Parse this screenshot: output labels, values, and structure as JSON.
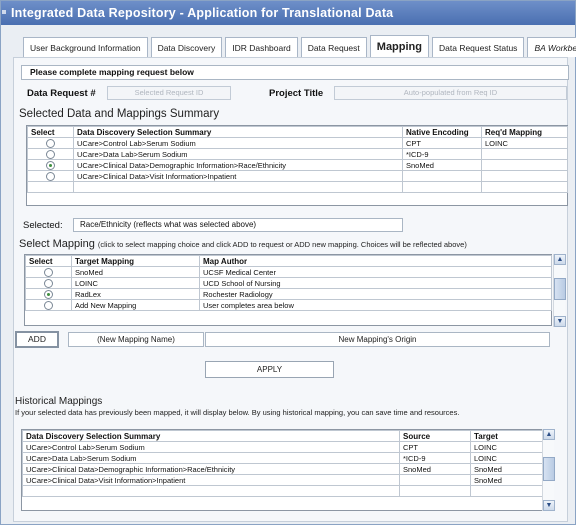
{
  "app": {
    "title": "Integrated Data Repository - Application for Translational Data"
  },
  "tabs": [
    {
      "label": "User Background Information",
      "active": false
    },
    {
      "label": "Data Discovery",
      "active": false
    },
    {
      "label": "IDR Dashboard",
      "active": false
    },
    {
      "label": "Data Request",
      "active": false
    },
    {
      "label": "Mapping",
      "active": true
    },
    {
      "label": "Data Request Status",
      "active": false
    },
    {
      "label": "BA Workbench",
      "active": false
    }
  ],
  "instruction": "Please complete mapping request below",
  "request": {
    "label": "Data Request #",
    "placeholder": "Selected Request ID",
    "project_label": "Project Title",
    "project_placeholder": "Auto-populated from Req ID"
  },
  "summary": {
    "title": "Selected Data and Mappings Summary",
    "headers": [
      "Select",
      "Data Discovery Selection Summary",
      "Native Encoding",
      "Req'd Mapping"
    ],
    "rows": [
      {
        "selected": false,
        "summary": "UCare>Control Lab>Serum Sodium",
        "encoding": "CPT",
        "mapping": "LOINC"
      },
      {
        "selected": false,
        "summary": "UCare>Data Lab>Serum Sodium",
        "encoding": "*ICD-9",
        "mapping": ""
      },
      {
        "selected": true,
        "summary": "UCare>Clinical Data>Demographic Information>Race/Ethnicity",
        "encoding": "SnoMed",
        "mapping": ""
      },
      {
        "selected": false,
        "summary": "UCare>Clinical Data>Visit Information>Inpatient",
        "encoding": "",
        "mapping": ""
      }
    ]
  },
  "selected": {
    "label": "Selected:",
    "value": "Race/Ethnicity (reflects what was selected above)"
  },
  "mapping": {
    "title": "Select Mapping",
    "subtitle": "(click to select mapping choice and click ADD to request or ADD new mapping.  Choices will be reflected above)",
    "headers": [
      "Select",
      "Target Mapping",
      "Map Author"
    ],
    "rows": [
      {
        "selected": false,
        "target": "SnoMed",
        "author": "UCSF Medical Center"
      },
      {
        "selected": false,
        "target": "LOINC",
        "author": "UCD School of Nursing"
      },
      {
        "selected": true,
        "target": "RadLex",
        "author": "Rochester Radiology"
      },
      {
        "selected": false,
        "target": "Add New Mapping",
        "author": "User completes area below"
      }
    ],
    "add_label": "ADD",
    "new_name": "(New Mapping Name)",
    "new_origin": "New Mapping's Origin",
    "apply_label": "APPLY"
  },
  "history": {
    "title": "Historical Mappings",
    "desc": "If your selected data has previously been mapped, it will display below.  By using historical mapping, you can save time and resources.",
    "headers": [
      "Data Discovery Selection Summary",
      "Source",
      "Target"
    ],
    "rows": [
      {
        "summary": "UCare>Control Lab>Serum Sodium",
        "source": "CPT",
        "target": "LOINC"
      },
      {
        "summary": "UCare>Data Lab>Serum Sodium",
        "source": "*ICD-9",
        "target": "LOINC"
      },
      {
        "summary": "UCare>Clinical Data>Demographic Information>Race/Ethnicity",
        "source": "SnoMed",
        "target": "SnoMed"
      },
      {
        "summary": "UCare>Clinical Data>Visit Information>Inpatient",
        "source": "",
        "target": "SnoMed"
      }
    ]
  }
}
